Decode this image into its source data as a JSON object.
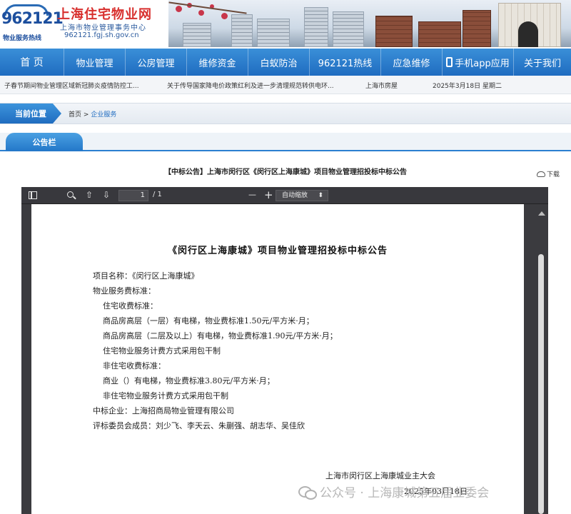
{
  "header": {
    "logo_number": "962121",
    "logo_subtitle": "物业服务热线",
    "site_title": "上海住宅物业网",
    "site_subtitle": "上海市物业管理事务中心",
    "site_domain": "962121.fgj.sh.gov.cn"
  },
  "nav": {
    "items": [
      {
        "label": "首 页"
      },
      {
        "label": "物业管理"
      },
      {
        "label": "公房管理"
      },
      {
        "label": "维修资金"
      },
      {
        "label": "白蚁防治"
      },
      {
        "label": "962121热线"
      },
      {
        "label": "应急维修"
      },
      {
        "label": "手机app应用",
        "icon": "phone-icon"
      },
      {
        "label": "关于我们"
      }
    ]
  },
  "ticker": {
    "news1": "子春节期间物业管理区域新冠肺炎疫情防控工...",
    "news2": "关于传导国家降电价政策红利及进一步清理规范转供电环...",
    "news3": "上海市房屋",
    "date": "2025年3月18日 星期二"
  },
  "breadcrumb": {
    "tag": "当前位置",
    "home": "首页",
    "separator": ">",
    "current": "企业服务"
  },
  "announcement": {
    "tab": "公告栏",
    "doc_title": "【中标公告】上海市闵行区《闵行区上海康城》项目物业管理招投标中标公告",
    "download": "下载"
  },
  "pdf": {
    "page_current": "1",
    "page_total": "/ 1",
    "zoom_minus": "—",
    "zoom_plus": "+",
    "zoom_value": "自动缩放",
    "zoom_arrow": "⬍"
  },
  "document": {
    "title": "《闵行区上海康城》项目物业管理招投标中标公告",
    "lines": [
      "项目名称：《闵行区上海康城》",
      "物业服务费标准：",
      "住宅收费标准：",
      "商品房高层（一层）有电梯，物业费标准1.50元/平方米·月；",
      "商品房高层（二层及以上）有电梯，物业费标准1.90元/平方米·月；",
      "住宅物业服务计费方式采用包干制",
      "非住宅收费标准：",
      "商业（）有电梯，物业费标准3.80元/平方米·月；",
      "非住宅物业服务计费方式采用包干制",
      "中标企业：上海招商局物业管理有限公司",
      "评标委员会成员：刘少飞、李天云、朱蒯强、胡志华、吴佳欣"
    ],
    "signature": "上海市闵行区上海康城业主大会",
    "date": "2025年03月18日"
  },
  "watermark": {
    "text": "公众号 · 上海康城第五届业委会"
  },
  "colors": {
    "nav_blue": "#1f6cc0",
    "title_red": "#d8302e",
    "viewer_dark": "#3b3b3f"
  }
}
